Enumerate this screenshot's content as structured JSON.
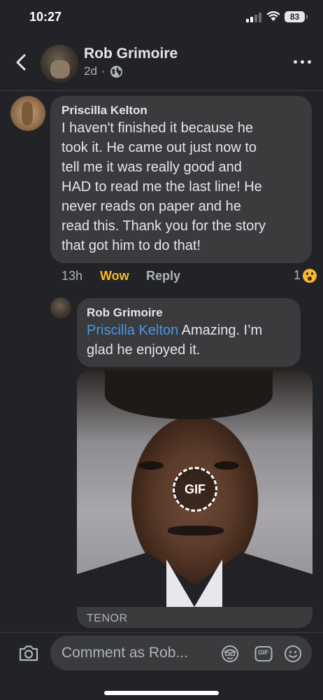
{
  "status_bar": {
    "time": "10:27",
    "battery": "83"
  },
  "header": {
    "name": "Rob Grimoire",
    "time_ago": "2d",
    "separator": "·",
    "icons": [
      "back-arrow-icon",
      "globe-icon",
      "more-icon"
    ]
  },
  "comment": {
    "author": "Priscilla Kelton",
    "text": "I haven't finished it because he\ntook it. He came out just now to\ntell me it was really good and\nHAD  to read me the last line! He\nnever reads on paper and he\nread this. Thank you for the story\nthat got him to do that!",
    "time": "13h",
    "reaction_label": "Wow",
    "reply_label": "Reply",
    "reaction_count": "1",
    "reaction_icon": "wow-emoji-icon"
  },
  "reply": {
    "author": "Rob Grimoire",
    "mention": "Priscilla Kelton",
    "text_line1": " Amazing. I’m",
    "text_line2": "glad he enjoyed it.",
    "gif_badge": "GIF",
    "gif_source": "TENOR"
  },
  "composer": {
    "placeholder": "Comment as Rob...",
    "icons": [
      "camera-icon",
      "avatar-sticker-icon",
      "gif-icon",
      "emoji-icon"
    ],
    "gif_label": "GIF"
  },
  "colors": {
    "background": "#222326",
    "bubble": "#3a3b3c",
    "mention": "#4b95e6",
    "wow": "#f7b928"
  }
}
